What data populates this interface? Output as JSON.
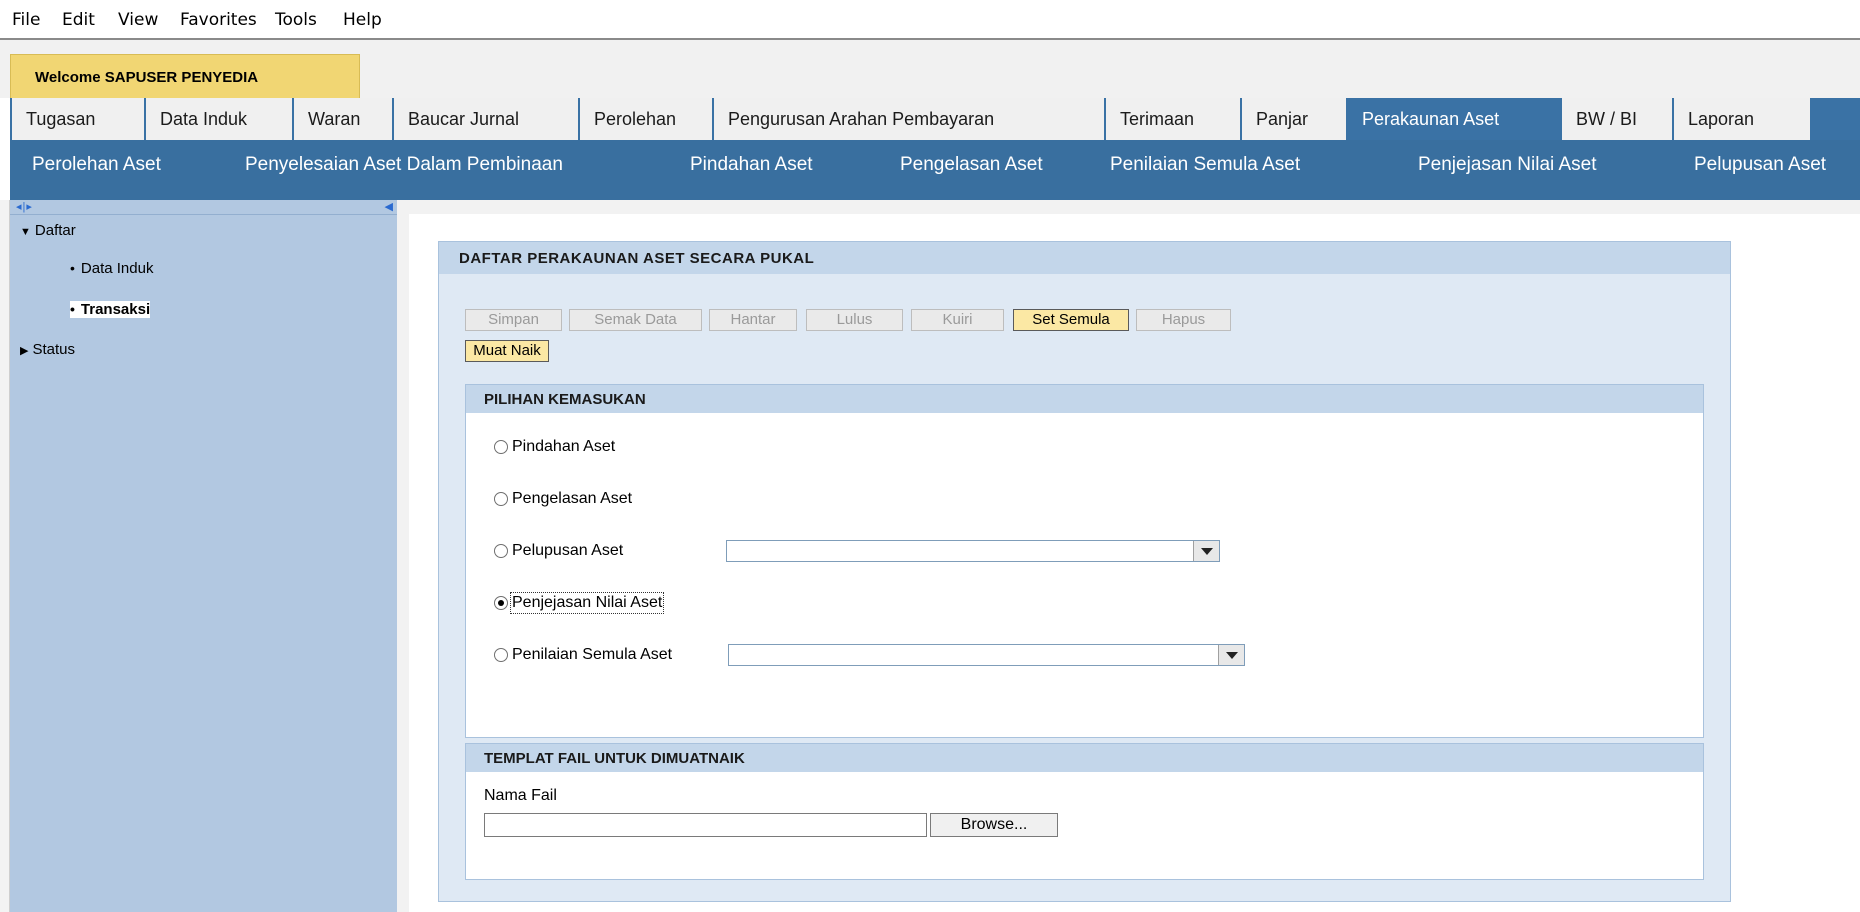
{
  "menubar": [
    "File",
    "Edit",
    "View",
    "Favorites",
    "Tools",
    "Help"
  ],
  "welcome": "Welcome SAPUSER PENYEDIA",
  "tabs": [
    "Tugasan",
    "Data Induk",
    "Waran",
    "Baucar Jurnal",
    "Perolehan",
    "Pengurusan Arahan Pembayaran",
    "Terimaan",
    "Panjar",
    "Perakaunan Aset",
    "BW / BI",
    "Laporan"
  ],
  "active_tab": "Perakaunan Aset",
  "subnav": [
    "Perolehan Aset",
    "Penyelesaian Aset Dalam Pembinaan",
    "Pindahan Aset",
    "Pengelasan Aset",
    "Penilaian Semula Aset",
    "Penjejasan Nilai Aset",
    "Pelupusan Aset"
  ],
  "tree": {
    "daftar": "Daftar",
    "data_induk": "Data Induk",
    "transaksi": "Transaksi",
    "status": "Status"
  },
  "panel": {
    "title": "DAFTAR PERAKAUNAN ASET SECARA PUKAL",
    "buttons": [
      "Simpan",
      "Semak Data",
      "Hantar",
      "Lulus",
      "Kuiri",
      "Set Semula",
      "Hapus"
    ],
    "active_button": "Set Semula",
    "upload_button": "Muat Naik"
  },
  "pilihan": {
    "title": "PILIHAN KEMASUKAN",
    "options": [
      "Pindahan Aset",
      "Pengelasan Aset",
      "Pelupusan Aset",
      "Penjejasan Nilai Aset",
      "Penilaian Semula Aset"
    ],
    "selected": "Penjejasan Nilai Aset",
    "pelupusan_value": "",
    "penilaian_value": ""
  },
  "templat": {
    "title": "TEMPLAT FAIL UNTUK DIMUATNAIK",
    "file_label": "Nama Fail",
    "file_value": "",
    "browse_label": "Browse..."
  }
}
